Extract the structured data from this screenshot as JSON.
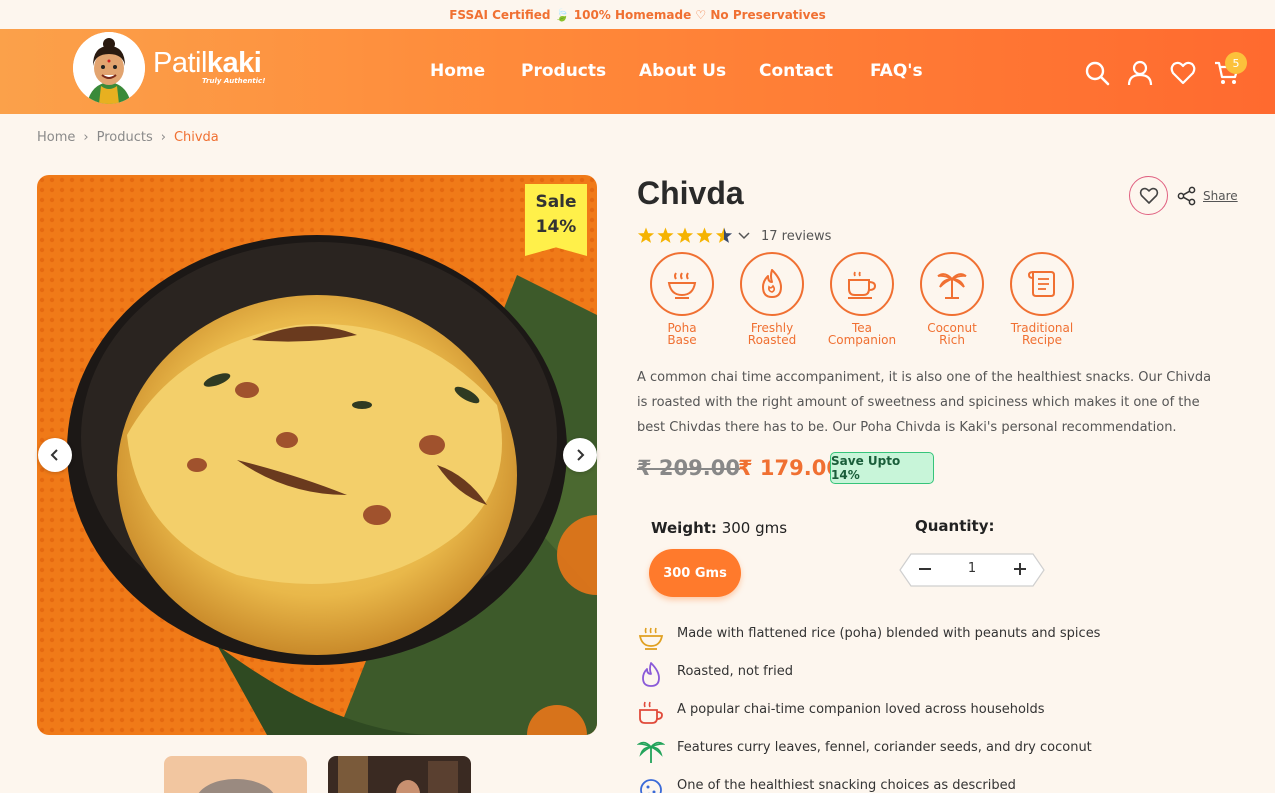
{
  "topbar": {
    "text": "FSSAI Certified 🍃 100% Homemade ♡ No Preservatives"
  },
  "brand": {
    "name_light": "Patil",
    "name_bold": "kaki",
    "tagline": "Truly Authentic!"
  },
  "nav": [
    "Home",
    "Products",
    "About Us",
    "Contact",
    "FAQ's"
  ],
  "header_icons": [
    "search-icon",
    "user-icon",
    "heart-icon",
    "cart-icon"
  ],
  "cart": {
    "count": "5"
  },
  "breadcrumb": [
    "Home",
    "Products",
    "Chivda"
  ],
  "product": {
    "sale_label": "Sale",
    "sale_percent": "14%",
    "title": "Chivda",
    "share_label": "Share",
    "reviews": "17 reviews",
    "rating": 4.5,
    "features": [
      {
        "line1": "Poha",
        "line2": "Base",
        "icon": "bowl-icon"
      },
      {
        "line1": "Freshly",
        "line2": "Roasted",
        "icon": "flame-icon"
      },
      {
        "line1": "Tea",
        "line2": "Companion",
        "icon": "tea-cup-icon"
      },
      {
        "line1": "Coconut",
        "line2": "Rich",
        "icon": "palm-tree-icon"
      },
      {
        "line1": "Traditional",
        "line2": "Recipe",
        "icon": "scroll-icon"
      }
    ],
    "description": "A common chai time accompaniment, it is also one of the healthiest snacks. Our Chivda is roasted with the right amount of sweetness and spiciness which makes it one of the best Chivdas there has to be. Our Poha Chivda is Kaki's personal recommendation.",
    "price_old": "₹ 209.00",
    "price_new": "₹ 179.00",
    "save_badge": "Save Upto 14%",
    "weight_label": "Weight:",
    "weight_value": "300 gms",
    "weight_option": "300 Gms",
    "quantity_label": "Quantity:",
    "quantity": "1",
    "bullets": [
      {
        "text": "Made with flattened rice (poha) blended with peanuts and spices",
        "icon": "bowl-icon",
        "color": "#e0a020"
      },
      {
        "text": "Roasted, not fried",
        "icon": "flame-icon",
        "color": "#8a5ad8"
      },
      {
        "text": "A popular chai-time companion loved across households",
        "icon": "tea-cup-icon",
        "color": "#e04a3a"
      },
      {
        "text": "Features curry leaves, fennel, coriander seeds, and dry coconut",
        "icon": "palm-tree-icon",
        "color": "#22a35a"
      },
      {
        "text": "One of the healthiest snacking choices as described",
        "icon": "cookie-icon",
        "color": "#3a6ad8"
      }
    ]
  },
  "colors": {
    "accent": "#f07032",
    "header_start": "#fba14a",
    "header_end": "#ff6a2f",
    "background": "#fdf6ee",
    "sale_ribbon": "#fff04a"
  }
}
